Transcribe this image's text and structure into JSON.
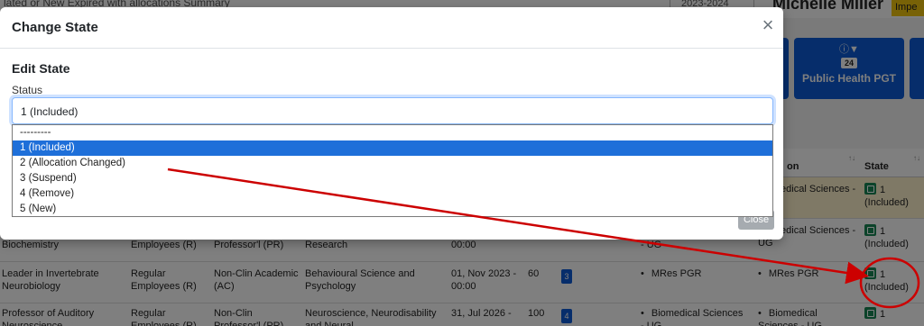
{
  "background": {
    "breadcrumbs": "lated or New    Expired with allocations    Summary",
    "year_select": "2023-2024",
    "user_name": "Michelle Miller",
    "imp_button": "Impe",
    "filter_cards": [
      {
        "label": "",
        "count": ""
      },
      {
        "label": "Public Health PGT",
        "count": "24"
      },
      {
        "label": "",
        "count": ""
      }
    ],
    "table": {
      "headers": {
        "program": "on",
        "state": "State"
      },
      "rows": [
        {
          "title": "",
          "employment": "",
          "role": "",
          "department": "",
          "date": "",
          "fte": "",
          "badge": "",
          "programme": "",
          "programme2": "Biomedical Sciences - UG",
          "state": "1 (Included)"
        },
        {
          "title": "Biochemistry",
          "employment": "Employees (R)",
          "role": "Professor'l (PR)",
          "department": "Research",
          "date": "00:00",
          "fte": "",
          "badge": "",
          "programme": "- UG",
          "programme2": "Biomedical Sciences - UG",
          "state": "1 (Included)"
        },
        {
          "title": "Leader in Invertebrate Neurobiology",
          "employment": "Regular Employees (R)",
          "role": "Non-Clin Academic (AC)",
          "department": "Behavioural Science and Psychology",
          "date": "01, Nov 2023 - 00:00",
          "fte": "60",
          "badge": "3",
          "programme": "MRes PGR",
          "programme2": "MRes PGR",
          "state": "1 (Included)"
        },
        {
          "title": "Professor of Auditory Neuroscience",
          "employment": "Regular Employees (R)",
          "role": "Non-Clin Professor'l (PR)",
          "department": "Neuroscience, Neurodisability and Neural",
          "date": "31, Jul 2026 -",
          "fte": "100",
          "badge": "4",
          "programme": "Biomedical Sciences - UG",
          "programme2": "Biomedical Sciences - UG",
          "state": "1"
        }
      ]
    }
  },
  "modal": {
    "title": "Change State",
    "section_title": "Edit State",
    "status_label": "Status",
    "status_value": "1 (Included)",
    "options": [
      "---------",
      "1 (Included)",
      "2 (Allocation Changed)",
      "3 (Suspend)",
      "4 (Remove)",
      "5 (New)"
    ],
    "selected_index": 1,
    "close_label": "Close"
  },
  "colors": {
    "accent": "#0d5bd6",
    "option_highlight": "#1e6fd9",
    "annotation": "#cc0000",
    "state_icon": "#198754"
  }
}
